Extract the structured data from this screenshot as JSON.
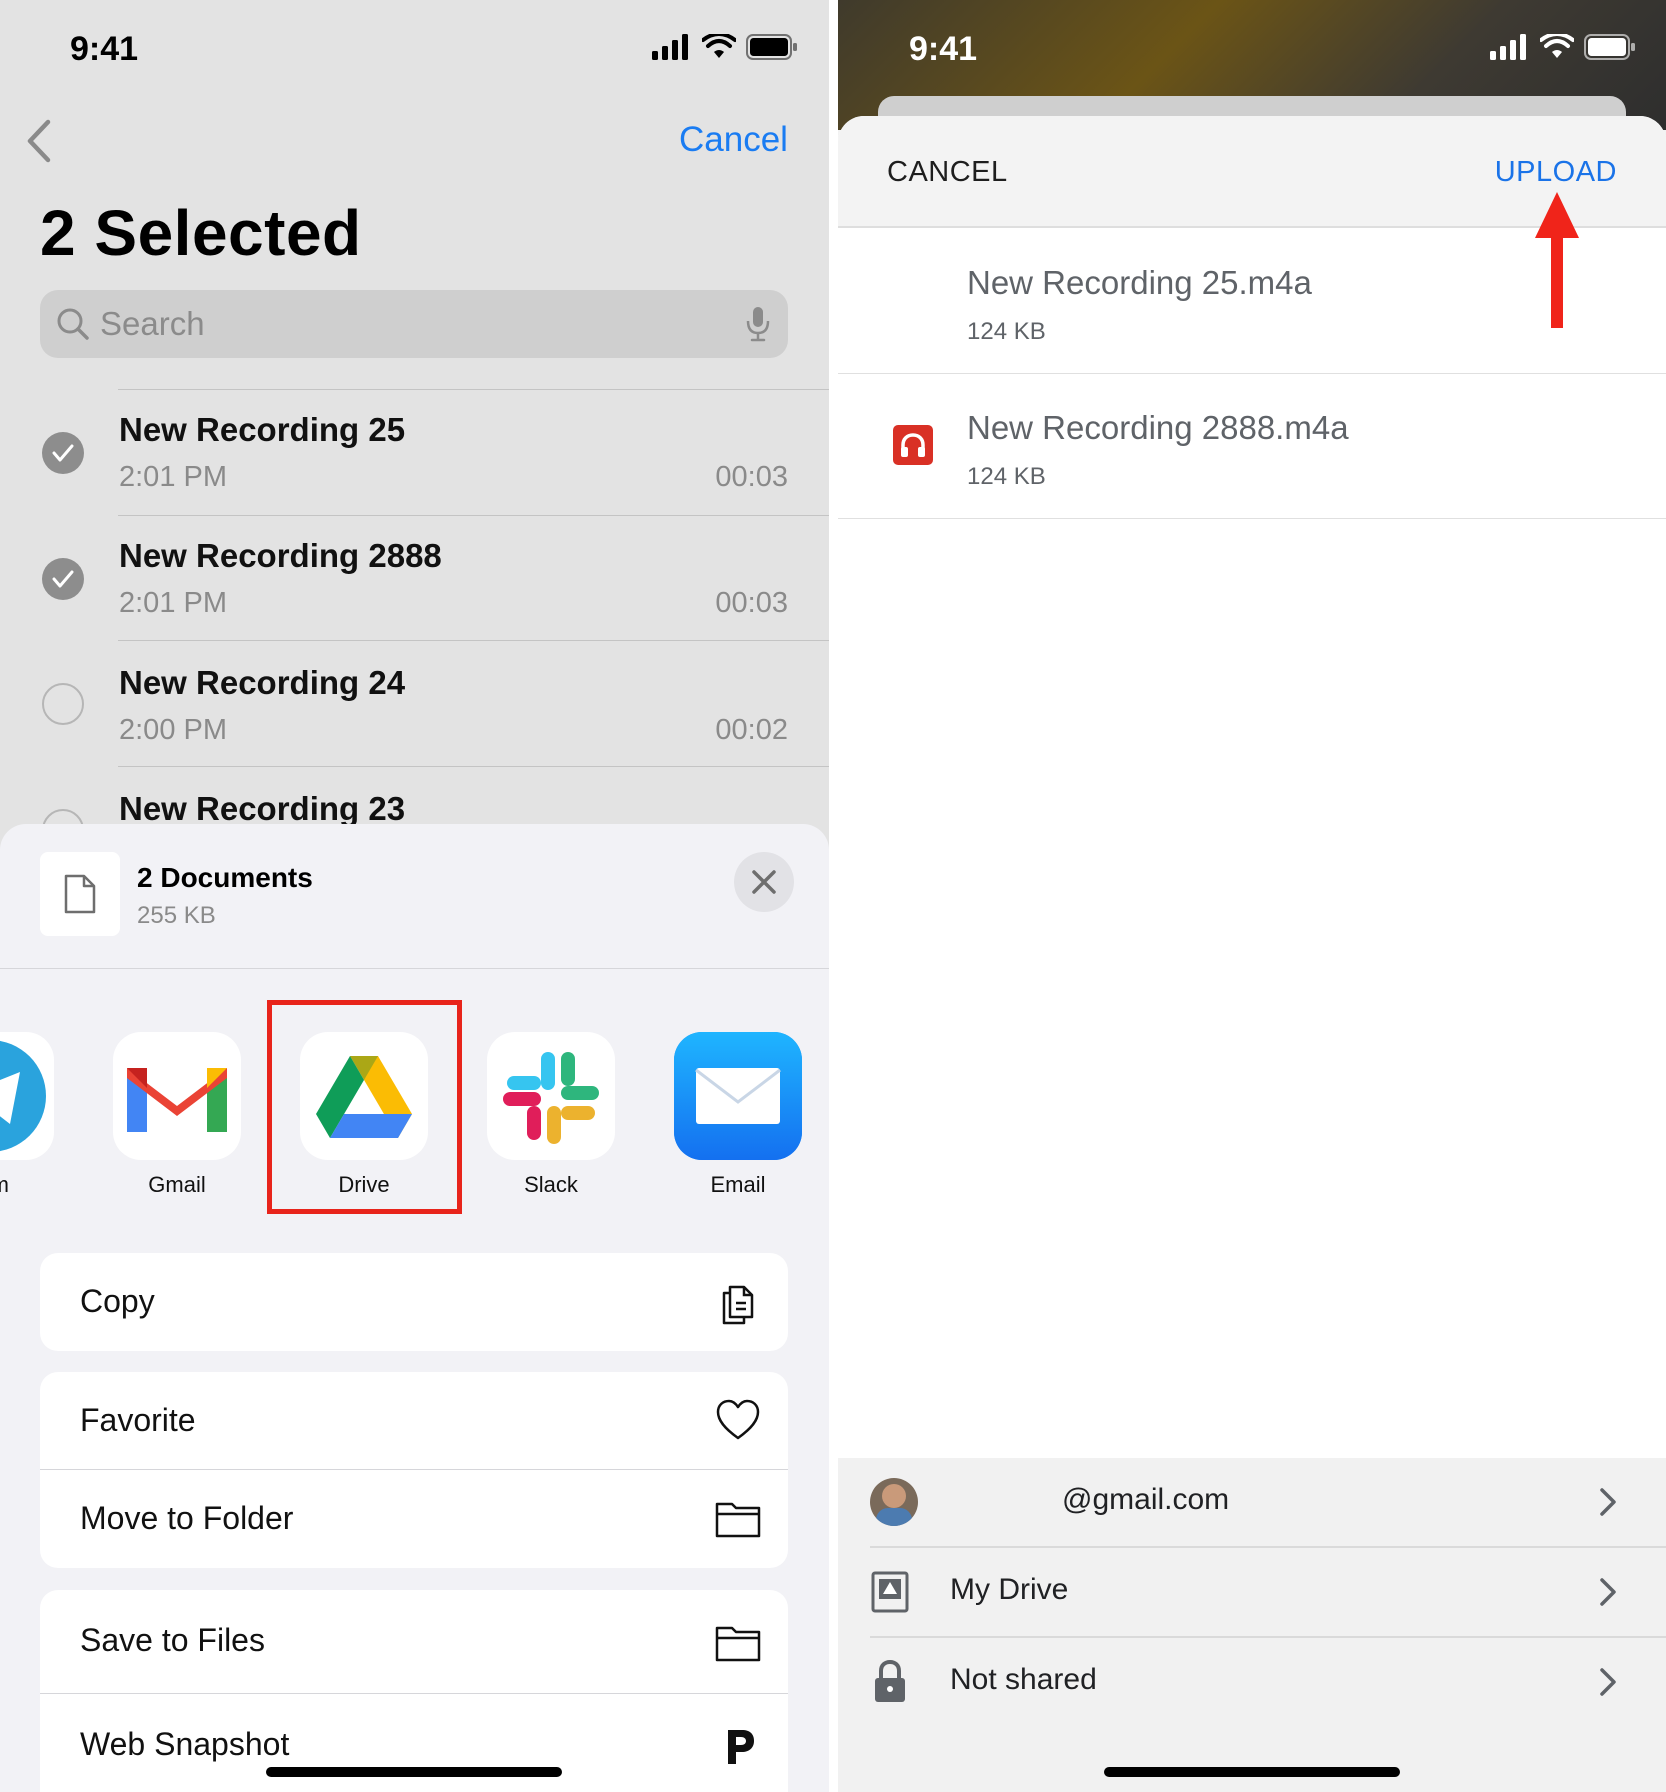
{
  "left": {
    "status": {
      "time": "9:41"
    },
    "nav": {
      "cancel": "Cancel"
    },
    "title": "2 Selected",
    "search": {
      "placeholder": "Search"
    },
    "recordings": [
      {
        "name": "New Recording 25",
        "time": "2:01 PM",
        "duration": "00:03",
        "selected": true
      },
      {
        "name": "New Recording 2888",
        "time": "2:01 PM",
        "duration": "00:03",
        "selected": true
      },
      {
        "name": "New Recording 24",
        "time": "2:00 PM",
        "duration": "00:02",
        "selected": false
      },
      {
        "name": "New Recording 23",
        "time": "",
        "duration": "",
        "selected": false
      }
    ],
    "share_sheet": {
      "doc_title": "2 Documents",
      "doc_size": "255 KB",
      "apps": [
        {
          "label": "ram",
          "icon": "telegram-icon"
        },
        {
          "label": "Gmail",
          "icon": "gmail-icon"
        },
        {
          "label": "Drive",
          "icon": "google-drive-icon"
        },
        {
          "label": "Slack",
          "icon": "slack-icon"
        },
        {
          "label": "Email",
          "icon": "mail-icon"
        }
      ],
      "actions_group1": [
        {
          "label": "Copy",
          "icon": "copy-icon"
        }
      ],
      "actions_group2": [
        {
          "label": "Favorite",
          "icon": "heart-icon"
        },
        {
          "label": "Move to Folder",
          "icon": "folder-icon"
        }
      ],
      "actions_group3": [
        {
          "label": "Save to Files",
          "icon": "folder-icon"
        },
        {
          "label": "Web Snapshot",
          "icon": "p-icon"
        }
      ]
    }
  },
  "right": {
    "status": {
      "time": "9:41"
    },
    "header": {
      "cancel": "CANCEL",
      "upload": "UPLOAD"
    },
    "files": [
      {
        "name": "New Recording 25.m4a",
        "size": "124 KB",
        "icon": ""
      },
      {
        "name": "New Recording 2888.m4a",
        "size": "124 KB",
        "icon": "audio-file-icon"
      }
    ],
    "destination": {
      "account": "@gmail.com",
      "folder": "My Drive",
      "sharing": "Not shared"
    }
  },
  "colors": {
    "ios_blue": "#1a7cf2",
    "drive_blue": "#1a73e8",
    "highlight_red": "#e8241b",
    "audio_red": "#d93025"
  }
}
